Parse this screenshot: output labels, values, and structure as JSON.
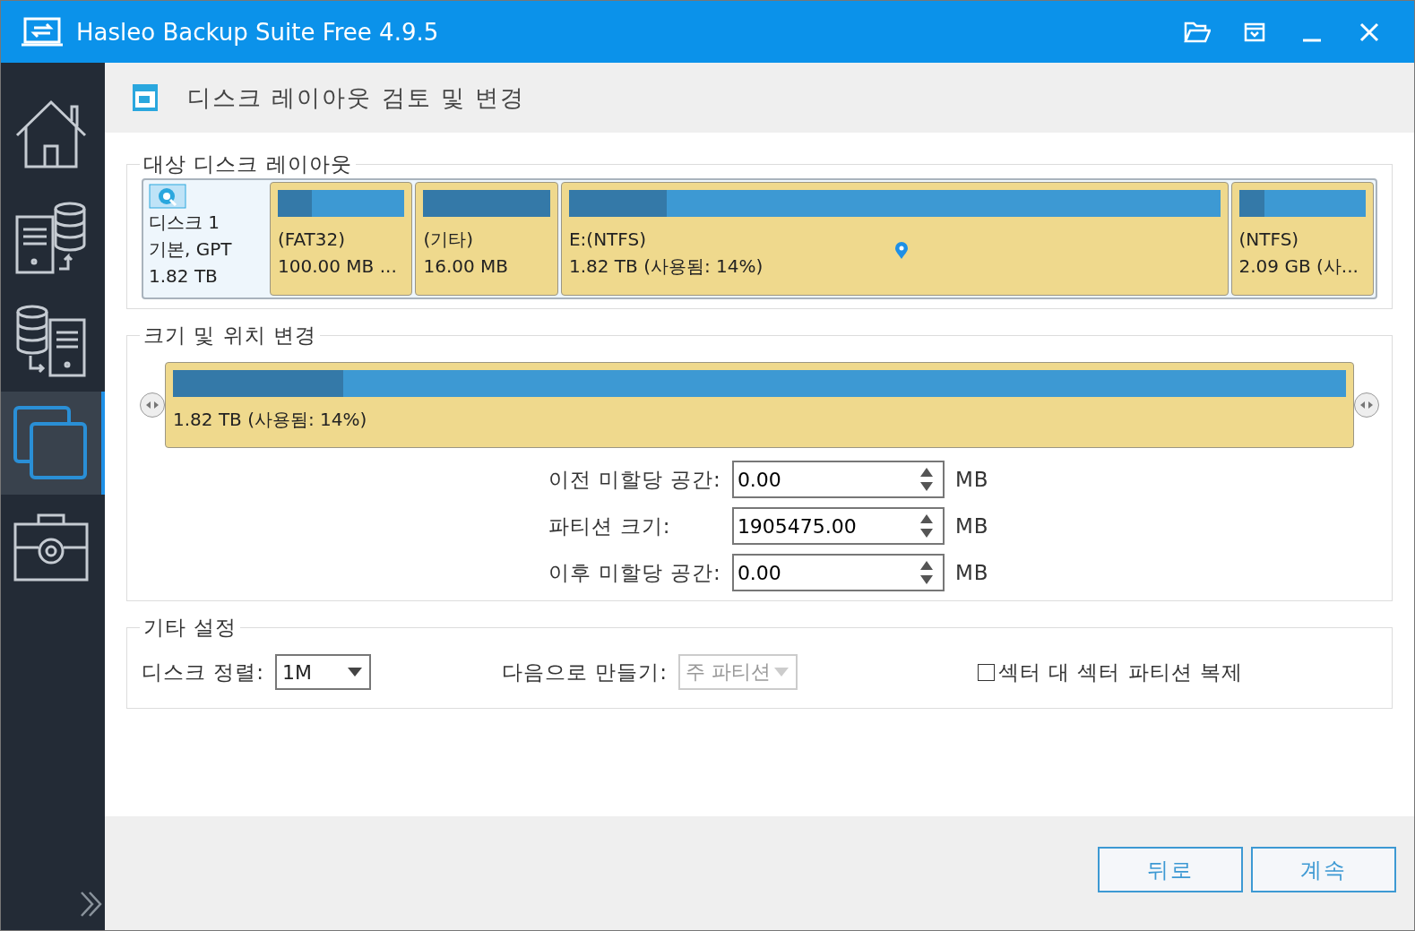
{
  "window": {
    "title": "Hasleo Backup Suite Free 4.9.5"
  },
  "sidebar": {
    "items": [
      {
        "kind": "home",
        "selected": false
      },
      {
        "kind": "backup",
        "selected": false
      },
      {
        "kind": "restore",
        "selected": false
      },
      {
        "kind": "clone",
        "selected": true
      },
      {
        "kind": "tools",
        "selected": false
      }
    ]
  },
  "header": {
    "title": "디스크 레이아웃 검토 및 변경"
  },
  "target_layout": {
    "legend": "대상 디스크 레이아웃",
    "disk": {
      "name": "디스크 1",
      "type": "기본, GPT",
      "size": "1.82 TB"
    },
    "partitions": [
      {
        "label": "(FAT32)",
        "size": "100.00 MB ...",
        "level": 0.27,
        "current": false
      },
      {
        "label": "(기타)",
        "size": "16.00 MB",
        "level": 1,
        "current": false
      },
      {
        "label": "E:(NTFS)",
        "size": "1.82 TB (사용됨: 14%)",
        "level": 0.15,
        "current": true
      },
      {
        "label": "(NTFS)",
        "size": "2.09 GB (사...",
        "level": 0.2,
        "current": false
      }
    ]
  },
  "resize": {
    "legend": "크기 및 위치 변경",
    "bar": {
      "text": "1.82 TB (사용됨: 14%)",
      "level": 0.145
    },
    "fields": [
      {
        "label": "이전 미할당 공간:",
        "value": "0.00",
        "unit": "MB"
      },
      {
        "label": "파티션 크기:",
        "value": "1905475.00",
        "unit": "MB"
      },
      {
        "label": "이후 미할당 공간:",
        "value": "0.00",
        "unit": "MB"
      }
    ]
  },
  "other": {
    "legend": "기타 설정",
    "alignment": {
      "label": "디스크 정렬:",
      "value": "1M",
      "disabled": false
    },
    "create_as": {
      "label": "다음으로 만들기:",
      "value": "주 파티션",
      "disabled": true
    },
    "sector_copy": {
      "label": "섹터 대 섹터 파티션 복제",
      "checked": false
    }
  },
  "buttons": [
    {
      "label": "뒤로"
    },
    {
      "label": "계속"
    }
  ]
}
